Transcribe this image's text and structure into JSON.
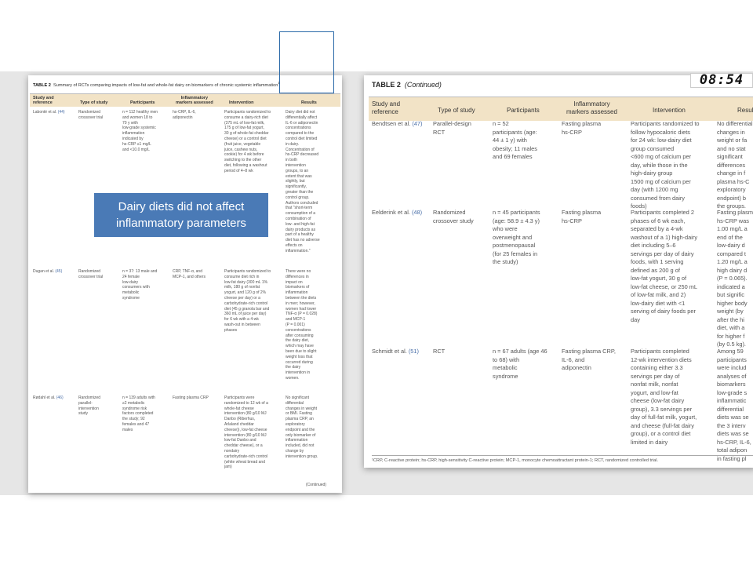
{
  "clock": "08:54",
  "callout": {
    "line1": "Dairy diets did not affect",
    "line2": "inflammatory parameters"
  },
  "left_table": {
    "caption_label": "TABLE 2",
    "caption_text": "Summary of RCTs comparing impacts of low-fat and whole-fat dairy on biomarkers of chronic systemic inflammation",
    "caption_mark": "1",
    "headers": {
      "study_line1": "Study and",
      "study_line2": "reference",
      "type": "Type of study",
      "participants": "Participants",
      "markers_line1": "Inflammatory",
      "markers_line2": "markers assessed",
      "intervention": "Intervention",
      "results": "Results"
    },
    "rows": [
      {
        "study": "Labonté et al.",
        "ref": "(44)",
        "type": [
          "Randomized",
          "crossover trial"
        ],
        "participants": [
          "n = 112 healthy men",
          "and women 18 to",
          "70 y with",
          "low-grade systemic",
          "inflammation",
          "indicated by",
          "hs-CRP ≥1 mg/L",
          "and <10.0 mg/L"
        ],
        "markers": [
          "hs-CRP, IL-6,",
          "adiponectin"
        ],
        "intervention": [
          "Participants randomized to",
          "consume a dairy-rich diet",
          "(375 mL of low-fat milk,",
          "175 g of low-fat yogurt,",
          "30 g of whole-fat cheddar",
          "cheese) or a control diet",
          "(fruit juice, vegetable",
          "juice, cashew nuts,",
          "cookie) for 4 wk before",
          "switching to the other",
          "diet, following a washout",
          "period of 4–8 wk"
        ],
        "results": [
          "Dairy diet did not",
          "differentially affect",
          "IL-6 or adiponectin",
          "concentrations",
          "compared to the",
          "control diet limited",
          "in dairy.",
          "Concentration of",
          "hs-CRP decreased",
          "in both",
          "intervention",
          "groups, to an",
          "extent that was",
          "slightly, but",
          "significantly,",
          "greater than the",
          "control group.",
          "Authors concluded",
          "that \"short-term",
          "consumption of a",
          "combination of",
          "low- and high-fat",
          "dairy products as",
          "part of a healthy",
          "diet has no adverse",
          "effects on",
          "inflammation.\""
        ]
      },
      {
        "study": "Dugan et al.",
        "ref": "(45)",
        "type": [
          "Randomized",
          "crossover trial"
        ],
        "participants": [
          "n = 37: 13 male and",
          "24 female",
          "low-dairy",
          "consumers with",
          "metabolic",
          "syndrome"
        ],
        "markers": [
          "CRP, TNF-α, and",
          "MCP-1, and others"
        ],
        "intervention": [
          "Participants randomized to",
          "consume diet rich in",
          "low-fat dairy (300 mL 1%",
          "milk, 180 g of nonfat",
          "yogurt, and 120 g of 2%",
          "cheese per day) or a",
          "carbohydrate-rich control",
          "diet (45 g granola bar and",
          "360 mL of juice per day)",
          "for 6 wk with a 4-wk",
          "wash-out in between",
          "phases"
        ],
        "results": [
          "There were no",
          "differences in",
          "impact on",
          "biomarkers of",
          "inflammation",
          "between the diets",
          "in men; however,",
          "women had lower",
          "TNF-α (P = 0.028)",
          "and MCP-1",
          "(P = 0.001)",
          "concentrations",
          "after consuming",
          "the dairy diet,",
          "which may have",
          "been due to slight",
          "weight loss that",
          "occurred during",
          "the dairy",
          "intervention in",
          "women."
        ]
      },
      {
        "study": "Rødahl et al.",
        "ref": "(46)",
        "type": [
          "Randomized",
          "parallel-",
          "intervention",
          "study"
        ],
        "participants": [
          "n = 139 adults with",
          "≥2 metabolic",
          "syndrome risk",
          "factors completed",
          "the study; 92",
          "females and 47",
          "males"
        ],
        "markers": [
          "Fasting plasma CRP"
        ],
        "intervention": [
          "Participants were",
          "randomized to 12 wk of a",
          "whole-fat cheese",
          "intervention (80 g/10 MJ",
          "Danbo (Riberhus,",
          "Arlaland cheddar",
          "cheese)), low-fat cheese",
          "intervention (80 g/10 MJ",
          "low-fat Danbo and",
          "cheddar cheese), or a",
          "nondairy",
          "carbohydrate-rich control",
          "(white wheat bread and",
          "jam)"
        ],
        "results": [
          "No significant",
          "differential",
          "changes in weight",
          "or BMI. Fasting",
          "plasma CRP, an",
          "exploratory",
          "endpoint and the",
          "only biomarker of",
          "inflammation",
          "included, did not",
          "change by",
          "intervention group."
        ]
      }
    ],
    "continued": "(Continued)"
  },
  "right_table": {
    "caption_label": "TABLE 2",
    "caption_suffix": "(Continued)",
    "headers": {
      "study_line1": "Study and",
      "study_line2": "reference",
      "type": "Type of study",
      "participants": "Participants",
      "markers_line1": "Inflammatory",
      "markers_line2": "markers assessed",
      "intervention": "Intervention",
      "results": "Result"
    },
    "rows": [
      {
        "study": "Bendtsen et al.",
        "ref": "(47)",
        "type": [
          "Parallel-design",
          "RCT"
        ],
        "participants": [
          "n = 52",
          "participants (age:",
          "44 ± 1 y) with",
          "obesity; 11 males",
          "and 69 females"
        ],
        "markers": [
          "Fasting plasma",
          "hs-CRP"
        ],
        "intervention": [
          "Participants randomized to",
          "follow hypocaloric diets",
          "for 24 wk: low-dairy diet",
          "group consumed",
          "<600 mg of calcium per",
          "day, while those in the",
          "high-dairy group",
          "1500 mg of calcium per",
          "day (with 1200 mg",
          "consumed from dairy",
          "foods)"
        ],
        "results": [
          "No differential",
          "changes in",
          "weight or fa",
          "and no stat",
          "significant",
          "differences",
          "change in f",
          "plasma hs-C",
          "exploratory",
          "endpoint) b",
          "the groups."
        ]
      },
      {
        "study": "Eelderink et al.",
        "ref": "(48)",
        "type": [
          "Randomized",
          "crossover study"
        ],
        "participants": [
          "n = 45 participants",
          "(age: 58.9 ± 4.3 y)",
          "who were",
          "overweight and",
          "postmenopausal",
          "(for 25 females in",
          "the study)"
        ],
        "markers": [
          "Fasting plasma",
          "hs-CRP"
        ],
        "intervention": [
          "Participants completed 2",
          "phases of 6 wk each,",
          "separated by a 4-wk",
          "washout of a 1) high-dairy",
          "diet including 5–6",
          "servings per day of dairy",
          "foods, with 1 serving",
          "defined as 200 g of",
          "low-fat yogurt, 30 g of",
          "low-fat cheese, or 250 mL",
          "of low-fat milk, and 2)",
          "low-dairy diet with <1",
          "serving of dairy foods per",
          "day"
        ],
        "results": [
          "Fasting plasm",
          "hs-CRP was",
          "1.00 mg/L a",
          "end of the",
          "low-dairy d",
          "compared t",
          "1.20 mg/L a",
          "high dairy d",
          "(P = 0.065).",
          "indicated a",
          "but signific",
          "higher body",
          "weight (by",
          "after the hi",
          "diet, with a",
          "for higher f",
          "(by 0.5 kg)."
        ]
      },
      {
        "study": "Schmidt et al.",
        "ref": "(51)",
        "type": [
          "RCT"
        ],
        "participants": [
          "n = 67 adults (age 46",
          "to 68) with",
          "metabolic",
          "syndrome"
        ],
        "markers": [
          "Fasting plasma CRP,",
          "IL-6, and",
          "adiponectin"
        ],
        "intervention": [
          "Participants completed",
          "12-wk intervention diets",
          "containing either 3.3",
          "servings per day of",
          "nonfat milk, nonfat",
          "yogurt, and low-fat",
          "cheese (low-fat dairy",
          "group), 3.3 servings per",
          "day of full-fat milk, yogurt,",
          "and cheese (full-fat dairy",
          "group), or a control diet",
          "limited in dairy"
        ],
        "results": [
          "Among 59",
          "participants",
          "were includ",
          "analyses of",
          "biomarkers",
          "low-grade s",
          "inflammatic",
          "differential",
          "diets was se",
          "the 3 interv",
          "diets was se",
          "hs-CRP, IL-6,",
          "total adipon",
          "in fasting pl"
        ]
      }
    ],
    "footnote": "¹CRP, C-reactive protein; hs-CRP, high-sensitivity C-reactive protein; MCP-1, monocyte chemoattractant protein-1; RCT, randomized controlled trial."
  }
}
